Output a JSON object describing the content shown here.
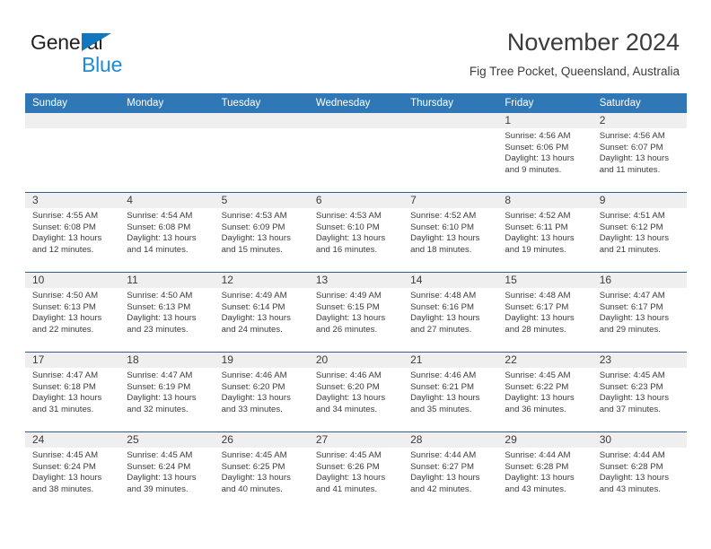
{
  "brand": {
    "name_part1": "General",
    "name_part2": "Blue",
    "triangle_color": "#1278be",
    "blue_color": "#1e8bd4"
  },
  "header": {
    "title": "November 2024",
    "subtitle": "Fig Tree Pocket, Queensland, Australia"
  },
  "theme": {
    "header_blue": "#2f78b5",
    "row_divider": "#2f5f8a",
    "day_strip_gray": "#efefef",
    "text": "#3c3c3c"
  },
  "calendar": {
    "weekday_headers": [
      "Sunday",
      "Monday",
      "Tuesday",
      "Wednesday",
      "Thursday",
      "Friday",
      "Saturday"
    ],
    "labels": {
      "sunrise": "Sunrise:",
      "sunset": "Sunset:",
      "daylight": "Daylight:"
    },
    "weeks": [
      [
        {
          "empty": true
        },
        {
          "empty": true
        },
        {
          "empty": true
        },
        {
          "empty": true
        },
        {
          "empty": true
        },
        {
          "day": "1",
          "sunrise": "Sunrise: 4:56 AM",
          "sunset": "Sunset: 6:06 PM",
          "daylight": "Daylight: 13 hours and 9 minutes."
        },
        {
          "day": "2",
          "sunrise": "Sunrise: 4:56 AM",
          "sunset": "Sunset: 6:07 PM",
          "daylight": "Daylight: 13 hours and 11 minutes."
        }
      ],
      [
        {
          "day": "3",
          "sunrise": "Sunrise: 4:55 AM",
          "sunset": "Sunset: 6:08 PM",
          "daylight": "Daylight: 13 hours and 12 minutes."
        },
        {
          "day": "4",
          "sunrise": "Sunrise: 4:54 AM",
          "sunset": "Sunset: 6:08 PM",
          "daylight": "Daylight: 13 hours and 14 minutes."
        },
        {
          "day": "5",
          "sunrise": "Sunrise: 4:53 AM",
          "sunset": "Sunset: 6:09 PM",
          "daylight": "Daylight: 13 hours and 15 minutes."
        },
        {
          "day": "6",
          "sunrise": "Sunrise: 4:53 AM",
          "sunset": "Sunset: 6:10 PM",
          "daylight": "Daylight: 13 hours and 16 minutes."
        },
        {
          "day": "7",
          "sunrise": "Sunrise: 4:52 AM",
          "sunset": "Sunset: 6:10 PM",
          "daylight": "Daylight: 13 hours and 18 minutes."
        },
        {
          "day": "8",
          "sunrise": "Sunrise: 4:52 AM",
          "sunset": "Sunset: 6:11 PM",
          "daylight": "Daylight: 13 hours and 19 minutes."
        },
        {
          "day": "9",
          "sunrise": "Sunrise: 4:51 AM",
          "sunset": "Sunset: 6:12 PM",
          "daylight": "Daylight: 13 hours and 21 minutes."
        }
      ],
      [
        {
          "day": "10",
          "sunrise": "Sunrise: 4:50 AM",
          "sunset": "Sunset: 6:13 PM",
          "daylight": "Daylight: 13 hours and 22 minutes."
        },
        {
          "day": "11",
          "sunrise": "Sunrise: 4:50 AM",
          "sunset": "Sunset: 6:13 PM",
          "daylight": "Daylight: 13 hours and 23 minutes."
        },
        {
          "day": "12",
          "sunrise": "Sunrise: 4:49 AM",
          "sunset": "Sunset: 6:14 PM",
          "daylight": "Daylight: 13 hours and 24 minutes."
        },
        {
          "day": "13",
          "sunrise": "Sunrise: 4:49 AM",
          "sunset": "Sunset: 6:15 PM",
          "daylight": "Daylight: 13 hours and 26 minutes."
        },
        {
          "day": "14",
          "sunrise": "Sunrise: 4:48 AM",
          "sunset": "Sunset: 6:16 PM",
          "daylight": "Daylight: 13 hours and 27 minutes."
        },
        {
          "day": "15",
          "sunrise": "Sunrise: 4:48 AM",
          "sunset": "Sunset: 6:17 PM",
          "daylight": "Daylight: 13 hours and 28 minutes."
        },
        {
          "day": "16",
          "sunrise": "Sunrise: 4:47 AM",
          "sunset": "Sunset: 6:17 PM",
          "daylight": "Daylight: 13 hours and 29 minutes."
        }
      ],
      [
        {
          "day": "17",
          "sunrise": "Sunrise: 4:47 AM",
          "sunset": "Sunset: 6:18 PM",
          "daylight": "Daylight: 13 hours and 31 minutes."
        },
        {
          "day": "18",
          "sunrise": "Sunrise: 4:47 AM",
          "sunset": "Sunset: 6:19 PM",
          "daylight": "Daylight: 13 hours and 32 minutes."
        },
        {
          "day": "19",
          "sunrise": "Sunrise: 4:46 AM",
          "sunset": "Sunset: 6:20 PM",
          "daylight": "Daylight: 13 hours and 33 minutes."
        },
        {
          "day": "20",
          "sunrise": "Sunrise: 4:46 AM",
          "sunset": "Sunset: 6:20 PM",
          "daylight": "Daylight: 13 hours and 34 minutes."
        },
        {
          "day": "21",
          "sunrise": "Sunrise: 4:46 AM",
          "sunset": "Sunset: 6:21 PM",
          "daylight": "Daylight: 13 hours and 35 minutes."
        },
        {
          "day": "22",
          "sunrise": "Sunrise: 4:45 AM",
          "sunset": "Sunset: 6:22 PM",
          "daylight": "Daylight: 13 hours and 36 minutes."
        },
        {
          "day": "23",
          "sunrise": "Sunrise: 4:45 AM",
          "sunset": "Sunset: 6:23 PM",
          "daylight": "Daylight: 13 hours and 37 minutes."
        }
      ],
      [
        {
          "day": "24",
          "sunrise": "Sunrise: 4:45 AM",
          "sunset": "Sunset: 6:24 PM",
          "daylight": "Daylight: 13 hours and 38 minutes."
        },
        {
          "day": "25",
          "sunrise": "Sunrise: 4:45 AM",
          "sunset": "Sunset: 6:24 PM",
          "daylight": "Daylight: 13 hours and 39 minutes."
        },
        {
          "day": "26",
          "sunrise": "Sunrise: 4:45 AM",
          "sunset": "Sunset: 6:25 PM",
          "daylight": "Daylight: 13 hours and 40 minutes."
        },
        {
          "day": "27",
          "sunrise": "Sunrise: 4:45 AM",
          "sunset": "Sunset: 6:26 PM",
          "daylight": "Daylight: 13 hours and 41 minutes."
        },
        {
          "day": "28",
          "sunrise": "Sunrise: 4:44 AM",
          "sunset": "Sunset: 6:27 PM",
          "daylight": "Daylight: 13 hours and 42 minutes."
        },
        {
          "day": "29",
          "sunrise": "Sunrise: 4:44 AM",
          "sunset": "Sunset: 6:28 PM",
          "daylight": "Daylight: 13 hours and 43 minutes."
        },
        {
          "day": "30",
          "sunrise": "Sunrise: 4:44 AM",
          "sunset": "Sunset: 6:28 PM",
          "daylight": "Daylight: 13 hours and 43 minutes."
        }
      ]
    ]
  }
}
